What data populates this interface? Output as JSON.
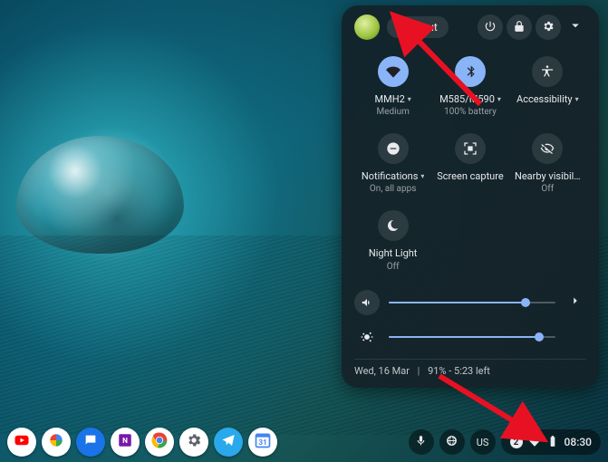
{
  "panel": {
    "signout": "Sign out",
    "tiles": {
      "wifi": {
        "label": "MMH2",
        "sub": "Medium"
      },
      "bt": {
        "label": "M585/M590",
        "sub": "100% battery"
      },
      "access": {
        "label": "Accessibility"
      },
      "notif": {
        "label": "Notifications",
        "sub": "On, all apps"
      },
      "capture": {
        "label": "Screen capture"
      },
      "nearby": {
        "label": "Nearby visibil…",
        "sub": "Off"
      },
      "night": {
        "label": "Night Light",
        "sub": "Off"
      }
    },
    "footer": {
      "date": "Wed, 16 Mar",
      "battery": "91% - 5:23 left"
    }
  },
  "shelf": {
    "lang": "US",
    "notif_count": "2",
    "time": "08:30"
  }
}
